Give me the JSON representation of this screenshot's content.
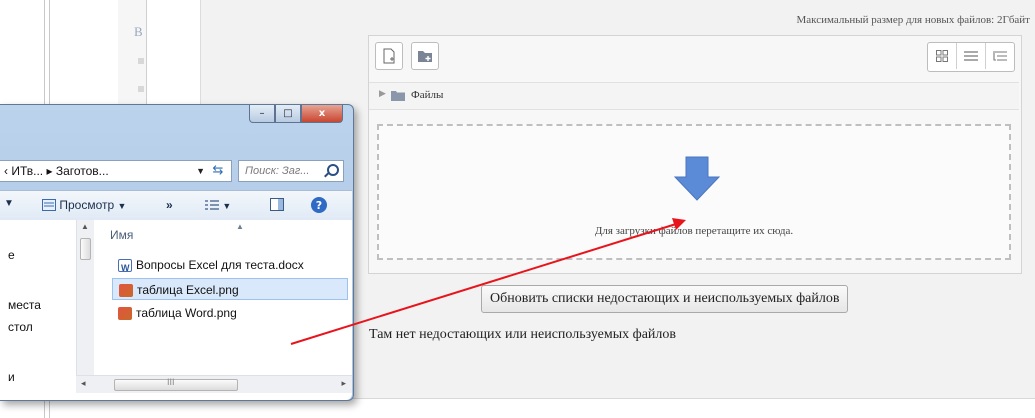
{
  "page": {
    "sidebar_glyph": "В",
    "max_size_text": "Максимальный размер для новых файлов: 2Гбайт",
    "path_label": "Файлы",
    "dropzone_text": "Для загрузки файлов перетащите их сюда.",
    "update_button": "Обновить списки недостающих и неиспользуемых файлов",
    "no_missing_text": "Там нет недостающих или неиспользуемых файлов"
  },
  "toolbar_icons": [
    "add-file-icon",
    "create-folder-icon",
    "grid-view-icon",
    "list-view-icon",
    "tree-view-icon"
  ],
  "explorer": {
    "controls": {
      "minimize": "–",
      "maximize": "□",
      "close": "x"
    },
    "address": "‹ ИТв... ▸ Заготов...",
    "search_placeholder": "Поиск: Заг...",
    "toolbar": {
      "view_label": "Просмотр",
      "more": "»"
    },
    "column_header": "Имя",
    "nav_items": [
      "е",
      "места",
      "стол",
      "и"
    ],
    "files": [
      {
        "name": "Вопросы Excel для теста.docx",
        "icon": "word-doc-icon",
        "selected": false
      },
      {
        "name": "таблица Excel.png",
        "icon": "png-image-icon",
        "selected": true
      },
      {
        "name": "таблица Word.png",
        "icon": "png-image-icon",
        "selected": false
      }
    ],
    "scroll_thumb_label": "III"
  },
  "colors": {
    "accent_arrow": "#5b8ad6",
    "drag_arrow": "#e8141c",
    "selection": "#d9e8fb"
  }
}
